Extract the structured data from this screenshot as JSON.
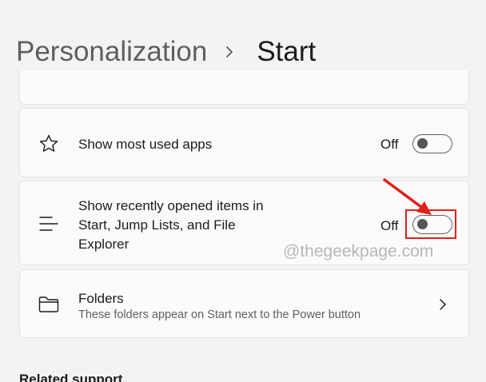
{
  "breadcrumb": {
    "parent": "Personalization",
    "current": "Start",
    "separator_icon": "chevron-right-icon"
  },
  "settings": [
    {
      "icon": "star-icon",
      "label": "Show most used apps",
      "state": "Off",
      "toggle_on": false
    },
    {
      "icon": "list-icon",
      "label_lines": [
        "Show recently opened items in",
        "Start, Jump Lists, and File",
        "Explorer"
      ],
      "state": "Off",
      "toggle_on": false
    }
  ],
  "folders": {
    "icon": "folder-icon",
    "label": "Folders",
    "description": "These folders appear on Start next to the Power button",
    "action_icon": "chevron-right-icon"
  },
  "watermark": "@thegeekpage.com",
  "related_heading": "Related support",
  "annotation": {
    "color": "#e0201a"
  }
}
